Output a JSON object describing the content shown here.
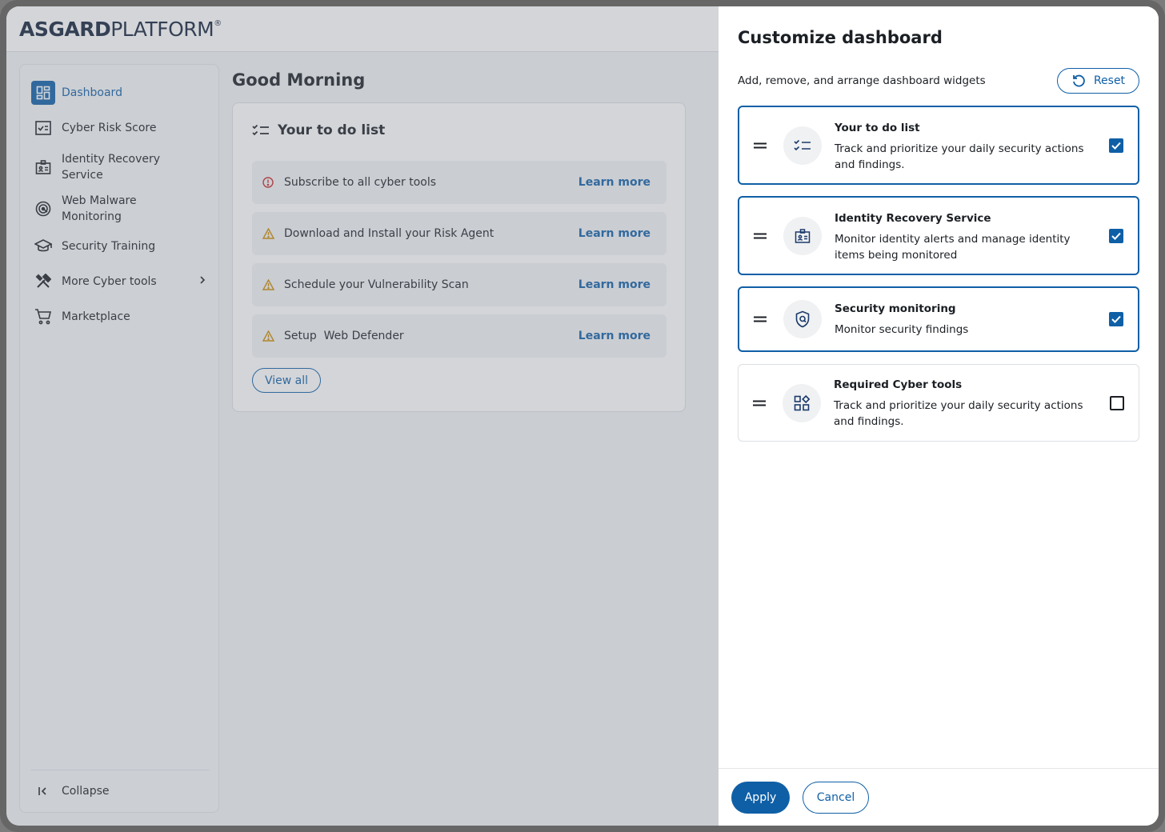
{
  "app": {
    "logo_bold": "ASGARD",
    "logo_light": "PLATFORM",
    "logo_mark": "®"
  },
  "sidebar": {
    "items": [
      {
        "label": "Dashboard",
        "icon": "dashboard-icon",
        "active": true
      },
      {
        "label": "Cyber Risk Score",
        "icon": "risk-score-icon"
      },
      {
        "label": "Identity Recovery Service",
        "icon": "id-badge-icon"
      },
      {
        "label": "Web Malware Monitoring",
        "icon": "target-icon"
      },
      {
        "label": "Security Training",
        "icon": "graduation-cap-icon"
      },
      {
        "label": "More Cyber tools",
        "icon": "tools-icon",
        "has_submenu": true
      },
      {
        "label": "Marketplace",
        "icon": "cart-icon"
      }
    ],
    "collapse_label": "Collapse"
  },
  "main": {
    "greeting": "Good Morning",
    "todo": {
      "title": "Your to do list",
      "items": [
        {
          "text": "Subscribe to all cyber tools",
          "status": "error",
          "link": "Learn more"
        },
        {
          "text": "Download and Install your Risk Agent",
          "status": "warning",
          "link": "Learn more"
        },
        {
          "text": "Schedule your Vulnerability Scan",
          "status": "warning",
          "link": "Learn more"
        },
        {
          "text": "Setup  Web Defender",
          "status": "warning",
          "link": "Learn more"
        }
      ],
      "view_all": "View all"
    }
  },
  "drawer": {
    "title": "Customize dashboard",
    "subtitle": "Add, remove, and arrange dashboard widgets",
    "reset_label": "Reset",
    "widgets": [
      {
        "name": "Your to do list",
        "desc": "Track and prioritize your daily security actions and findings.",
        "icon": "checklist-icon",
        "checked": true
      },
      {
        "name": "Identity Recovery Service",
        "desc": "Monitor identity alerts and manage identity items being monitored",
        "icon": "id-badge-icon",
        "checked": true
      },
      {
        "name": "Security monitoring",
        "desc": "Monitor security findings",
        "icon": "shield-icon",
        "checked": true
      },
      {
        "name": "Required Cyber tools",
        "desc": "Track and prioritize your daily security actions and findings.",
        "icon": "apps-icon",
        "checked": false
      }
    ],
    "apply_label": "Apply",
    "cancel_label": "Cancel"
  },
  "colors": {
    "primary": "#0f5fa6",
    "error": "#c62828",
    "warning": "#c98a00"
  }
}
